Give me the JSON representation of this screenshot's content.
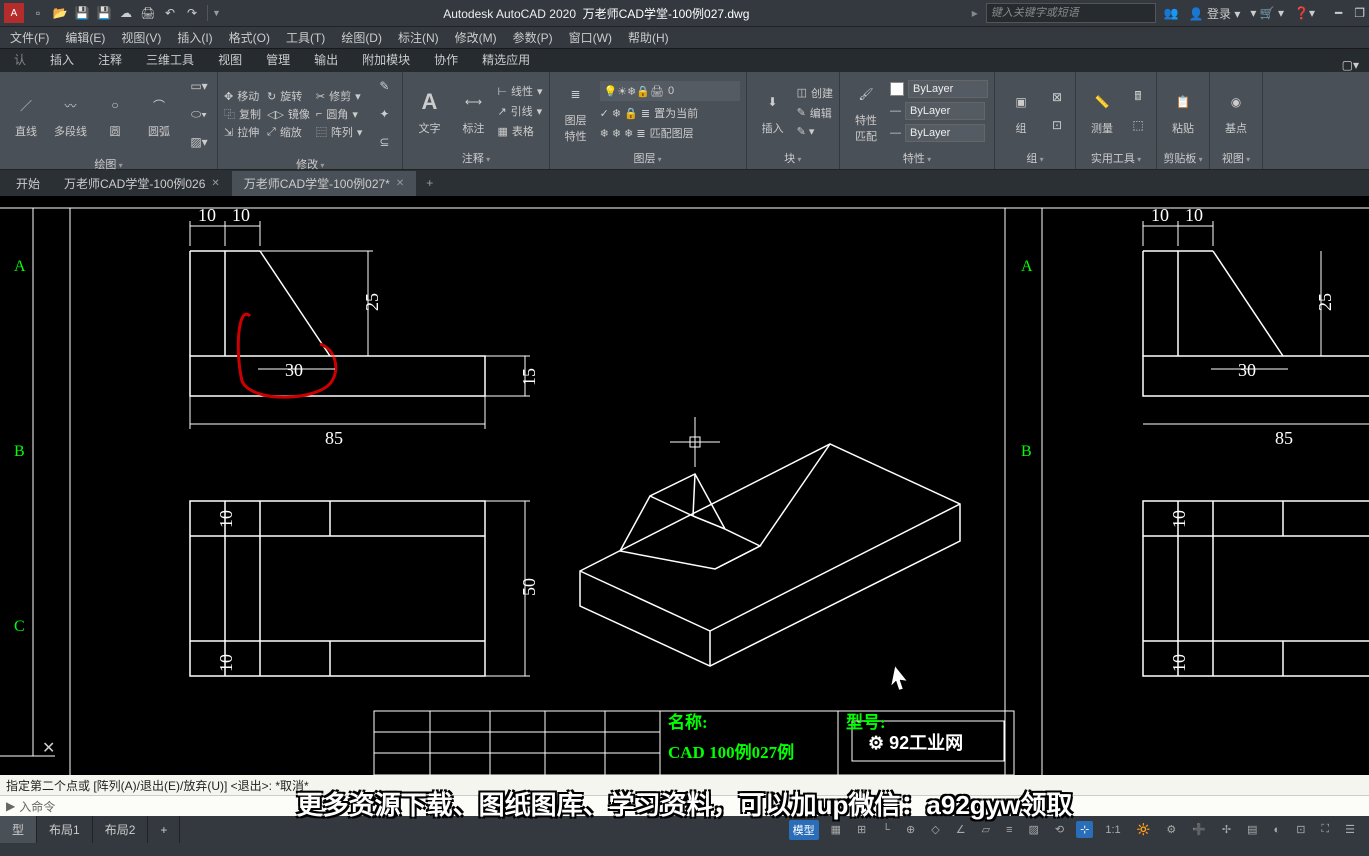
{
  "app": {
    "vendor": "Autodesk AutoCAD 2020",
    "filename": "万老师CAD学堂-100例027.dwg"
  },
  "search": {
    "placeholder": "键入关键字或短语"
  },
  "account": {
    "login": "登录"
  },
  "menus": [
    "文件(F)",
    "编辑(E)",
    "视图(V)",
    "插入(I)",
    "格式(O)",
    "工具(T)",
    "绘图(D)",
    "标注(N)",
    "修改(M)",
    "参数(P)",
    "窗口(W)",
    "帮助(H)"
  ],
  "ribbon_tabs": [
    "认",
    "插入",
    "注释",
    "三维工具",
    "视图",
    "管理",
    "输出",
    "附加模块",
    "协作",
    "精选应用"
  ],
  "panels": {
    "draw": {
      "title": "绘图",
      "items": [
        "直线",
        "多段线",
        "圆",
        "圆弧"
      ]
    },
    "modify": {
      "title": "修改",
      "row1": [
        "移动",
        "旋转",
        "修剪"
      ],
      "row2": [
        "复制",
        "镜像",
        "圆角"
      ],
      "row3": [
        "拉伸",
        "缩放",
        "阵列"
      ]
    },
    "annot": {
      "title": "注释",
      "text": "文字",
      "dim": "标注",
      "linear": "线性",
      "leader": "引线",
      "table": "表格"
    },
    "layers": {
      "title": "图层",
      "props": "图层\n特性",
      "current": "0",
      "row1": "置为当前",
      "row2": "匹配图层"
    },
    "block": {
      "title": "块",
      "insert": "插入",
      "create": "创建",
      "edit": "编辑"
    },
    "props": {
      "title": "特性",
      "match": "特性\n匹配",
      "bylayer": "ByLayer"
    },
    "group": {
      "title": "组",
      "btn": "组"
    },
    "util": {
      "title": "实用工具",
      "btn": "测量"
    },
    "clip": {
      "title": "剪贴板",
      "btn": "粘贴"
    },
    "view": {
      "title": "视图",
      "btn": "基点"
    }
  },
  "file_tabs": {
    "start": "开始",
    "t1": "万老师CAD学堂-100例026",
    "t2": "万老师CAD学堂-100例027*"
  },
  "drawing": {
    "dims": {
      "d10a": "10",
      "d10b": "10",
      "d25": "25",
      "d30": "30",
      "d15": "15",
      "d85": "85",
      "d50": "50",
      "d10c": "10",
      "d10d": "10"
    },
    "grid": {
      "A": "A",
      "B": "B",
      "C": "C"
    },
    "titleblock": {
      "name_lbl": "名称:",
      "name": "CAD 100例027例",
      "type_lbl": "型号:",
      "logo": "92工业网"
    }
  },
  "cmd": {
    "prompt": "指定第二个点或 [阵列(A)/退出(E)/放弃(U)] <退出>:  *取消*",
    "input": "入命令"
  },
  "layout_tabs": [
    "型",
    "布局1",
    "布局2"
  ],
  "status": {
    "model": "模型",
    "scale": "1:1"
  },
  "overlay": "更多资源下载、图纸图库、学习资料，可以加up微信：a92gyw领取"
}
